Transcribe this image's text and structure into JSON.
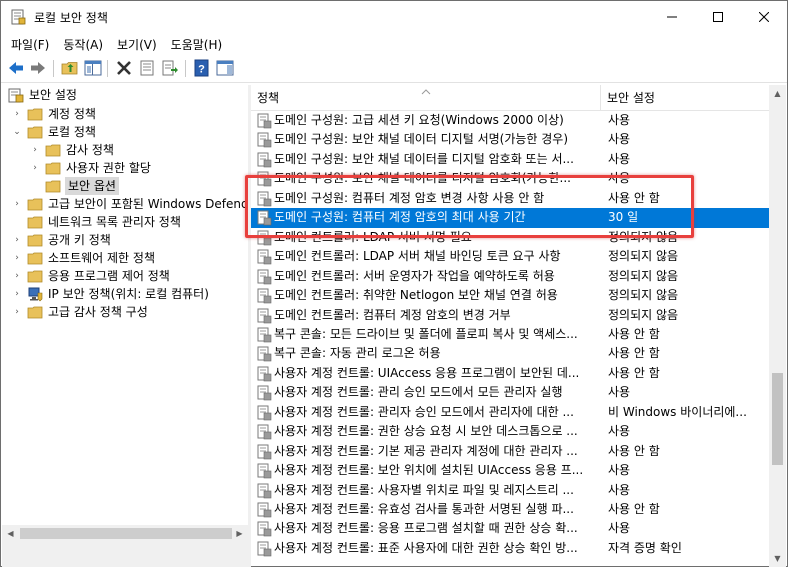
{
  "window": {
    "title": "로컬 보안 정책",
    "controls": {
      "minimize": "─",
      "maximize": "☐",
      "close": "✕"
    }
  },
  "menubar": {
    "items": [
      {
        "label": "파일(F)"
      },
      {
        "label": "동작(A)"
      },
      {
        "label": "보기(V)"
      },
      {
        "label": "도움말(H)"
      }
    ]
  },
  "toolbar": {
    "buttons": [
      {
        "icon": "back-arrow-icon"
      },
      {
        "icon": "forward-arrow-icon"
      },
      {
        "icon": "up-folder-icon"
      },
      {
        "icon": "show-hide-tree-icon"
      },
      {
        "icon": "delete-icon"
      },
      {
        "icon": "properties-icon"
      },
      {
        "icon": "export-list-icon"
      },
      {
        "icon": "help-icon"
      },
      {
        "icon": "show-action-pane-icon"
      }
    ],
    "colors": {
      "arrow": "#1d6fc9",
      "delete": "#333333",
      "help": "#2a5fb0"
    }
  },
  "tree": {
    "items": [
      {
        "label": "보안 설정",
        "expander": "",
        "icon": "security-settings-icon"
      },
      {
        "label": "계정 정책",
        "expander": "›",
        "icon": "folder-icon"
      },
      {
        "label": "로컬 정책",
        "expander": "⌄",
        "icon": "folder-icon"
      },
      {
        "label": "감사 정책",
        "expander": "›",
        "icon": "folder-icon"
      },
      {
        "label": "사용자 권한 할당",
        "expander": "›",
        "icon": "folder-icon"
      },
      {
        "label": "보안 옵션",
        "expander": "",
        "icon": "folder-icon"
      },
      {
        "label": "고급 보안이 포함된 Windows Defend",
        "expander": "›",
        "icon": "folder-icon"
      },
      {
        "label": "네트워크 목록 관리자 정책",
        "expander": "",
        "icon": "folder-icon"
      },
      {
        "label": "공개 키 정책",
        "expander": "›",
        "icon": "folder-icon"
      },
      {
        "label": "소프트웨어 제한 정책",
        "expander": "›",
        "icon": "folder-icon"
      },
      {
        "label": "응용 프로그램 제어 정책",
        "expander": "›",
        "icon": "folder-icon"
      },
      {
        "label": "IP 보안 정책(위치: 로컬 컴퓨터)",
        "expander": "›",
        "icon": "ip-security-icon"
      },
      {
        "label": "고급 감사 정책 구성",
        "expander": "›",
        "icon": "folder-icon"
      }
    ],
    "selected_index": 5
  },
  "list": {
    "columns": {
      "policy": "정책",
      "setting": "보안 설정"
    },
    "rows": [
      {
        "policy": "도메인 구성원: 고급 세션 키 요청(Windows 2000 이상)",
        "setting": "사용"
      },
      {
        "policy": "도메인 구성원: 보안 채널 데이터 디지털 서명(가능한 경우)",
        "setting": "사용"
      },
      {
        "policy": "도메인 구성원: 보안 채널 데이터를 디지털 암호화 또는 서...",
        "setting": "사용"
      },
      {
        "policy": "도메인 구성원: 보안 채널 데이터를 디지털 암호화(가능한...",
        "setting": "사용"
      },
      {
        "policy": "도메인 구성원: 컴퓨터 계정 암호 변경 사항 사용 안 함",
        "setting": "사용 안 함"
      },
      {
        "policy": "도메인 구성원: 컴퓨터 계정 암호의 최대 사용 기간",
        "setting": "30 일"
      },
      {
        "policy": "도메인 컨트롤러: LDAP 서버 서명 필요",
        "setting": "정의되지 않음"
      },
      {
        "policy": "도메인 컨트롤러: LDAP 서버 채널 바인딩 토큰 요구 사항",
        "setting": "정의되지 않음"
      },
      {
        "policy": "도메인 컨트롤러: 서버 운영자가 작업을 예약하도록 허용",
        "setting": "정의되지 않음"
      },
      {
        "policy": "도메인 컨트롤러: 취약한 Netlogon 보안 채널 연결 허용",
        "setting": "정의되지 않음"
      },
      {
        "policy": "도메인 컨트롤러: 컴퓨터 계정 암호의 변경 거부",
        "setting": "정의되지 않음"
      },
      {
        "policy": "복구 콘솔: 모든 드라이브 및 폴더에 플로피 복사 및 액세스...",
        "setting": "사용 안 함"
      },
      {
        "policy": "복구 콘솔: 자동 관리 로그온 허용",
        "setting": "사용 안 함"
      },
      {
        "policy": "사용자 계정 컨트롤: UIAccess 응용 프로그램이 보안된 데...",
        "setting": "사용 안 함"
      },
      {
        "policy": "사용자 계정 컨트롤: 관리 승인 모드에서 모든 관리자 실행",
        "setting": "사용"
      },
      {
        "policy": "사용자 계정 컨트롤: 관리자 승인 모드에서 관리자에 대한 ...",
        "setting": "비 Windows 바이너리에..."
      },
      {
        "policy": "사용자 계정 컨트롤: 권한 상승 요청 시 보안 데스크톱으로 ...",
        "setting": "사용"
      },
      {
        "policy": "사용자 계정 컨트롤: 기본 제공 관리자 계정에 대한 관리자 ...",
        "setting": "사용 안 함"
      },
      {
        "policy": "사용자 계정 컨트롤: 보안 위치에 설치된 UIAccess 응용 프...",
        "setting": "사용"
      },
      {
        "policy": "사용자 계정 컨트롤: 사용자별 위치로 파일 및 레지스트리 ...",
        "setting": "사용"
      },
      {
        "policy": "사용자 계정 컨트롤: 유효성 검사를 통과한 서명된 실행 파...",
        "setting": "사용 안 함"
      },
      {
        "policy": "사용자 계정 컨트롤: 응용 프로그램 설치할 때 권한 상승 확...",
        "setting": "사용"
      },
      {
        "policy": "사용자 계정 컨트롤: 표준 사용자에 대한 권한 상승 확인 방...",
        "setting": "자격 증명 확인"
      }
    ],
    "selected_index": 5,
    "colors": {
      "selection": "#0078d7",
      "highlight_box": "#e8403d"
    }
  },
  "scrollbars": {
    "vertical": {
      "up": "▲",
      "down": "▼"
    },
    "horizontal": {
      "left": "◀",
      "right": "▶"
    }
  }
}
